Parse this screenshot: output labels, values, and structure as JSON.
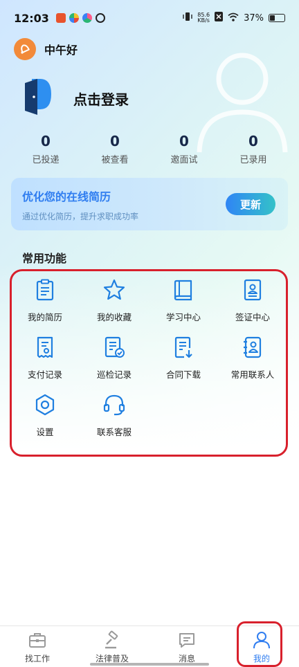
{
  "status_bar": {
    "time": "12:03",
    "net_speed_value": "85.6",
    "net_speed_unit": "KB/s",
    "battery_percent": "37%",
    "battery_level": 0.37
  },
  "header": {
    "greeting": "中午好",
    "login_label": "点击登录"
  },
  "stats": [
    {
      "value": "0",
      "label": "已投递"
    },
    {
      "value": "0",
      "label": "被查看"
    },
    {
      "value": "0",
      "label": "邀面试"
    },
    {
      "value": "0",
      "label": "已录用"
    }
  ],
  "resume_card": {
    "title": "优化您的在线简历",
    "subtitle": "通过优化简历，提升求职成功率",
    "button": "更新"
  },
  "functions": {
    "title": "常用功能",
    "items": [
      {
        "label": "我的简历",
        "icon": "clipboard-icon"
      },
      {
        "label": "我的收藏",
        "icon": "star-icon"
      },
      {
        "label": "学习中心",
        "icon": "book-icon"
      },
      {
        "label": "签证中心",
        "icon": "id-card-icon"
      },
      {
        "label": "支付记录",
        "icon": "receipt-icon"
      },
      {
        "label": "巡检记录",
        "icon": "checklist-icon"
      },
      {
        "label": "合同下载",
        "icon": "document-download-icon"
      },
      {
        "label": "常用联系人",
        "icon": "contacts-icon"
      },
      {
        "label": "设置",
        "icon": "settings-hexagon-icon"
      },
      {
        "label": "联系客服",
        "icon": "headset-icon"
      }
    ]
  },
  "tabs": [
    {
      "label": "找工作",
      "icon": "briefcase-icon"
    },
    {
      "label": "法律普及",
      "icon": "gavel-icon"
    },
    {
      "label": "消息",
      "icon": "message-icon"
    },
    {
      "label": "我的",
      "icon": "person-icon",
      "active": true
    }
  ],
  "colors": {
    "accent": "#2f7df0",
    "highlight": "#d8202c",
    "greeting_icon": "#f28a3a"
  }
}
